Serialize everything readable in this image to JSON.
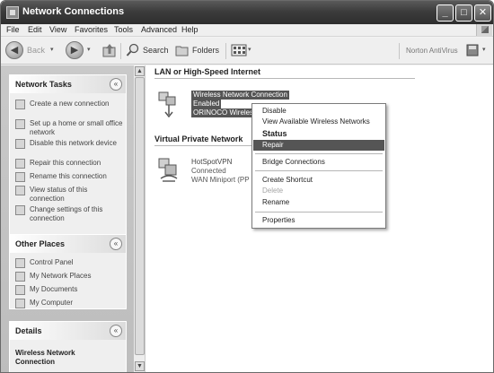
{
  "window": {
    "title": "Network Connections"
  },
  "titlebar_buttons": {
    "minimize": "_",
    "maximize": "□",
    "close": "✕"
  },
  "menu": [
    "File",
    "Edit",
    "View",
    "Favorites",
    "Tools",
    "Advanced",
    "Help"
  ],
  "toolbar": {
    "back": "Back",
    "forward_arrow": "▾",
    "search": "Search",
    "folders": "Folders",
    "norton": "Norton AntiVirus"
  },
  "left": {
    "network_tasks": {
      "title": "Network Tasks",
      "items": [
        "Create a new connection",
        "Set up a home or small office network",
        "Disable this network device",
        "Repair this connection",
        "Rename this connection",
        "View status of this connection",
        "Change settings of this connection"
      ]
    },
    "other_places": {
      "title": "Other Places",
      "items": [
        "Control Panel",
        "My Network Places",
        "My Documents",
        "My Computer"
      ]
    },
    "details": {
      "title": "Details",
      "name": "Wireless Network Connection"
    }
  },
  "groups": {
    "lan": "LAN or High-Speed Internet",
    "vpn": "Virtual Private Network"
  },
  "connections": {
    "wireless": {
      "name": "Wireless Network Connection",
      "status": "Enabled",
      "device": "ORINOCO Wireles"
    },
    "vpn": {
      "name": "HotSpotVPN",
      "status": "Connected",
      "device": "WAN Miniport (PP"
    }
  },
  "context_menu": {
    "items": [
      "Disable",
      "View Available Wireless Networks",
      "Status",
      "Repair",
      "Bridge Connections",
      "Create Shortcut",
      "Delete",
      "Rename",
      "Properties"
    ]
  },
  "icons": {
    "chevron": "«",
    "scroll_up": "▲",
    "scroll_down": "▼"
  }
}
